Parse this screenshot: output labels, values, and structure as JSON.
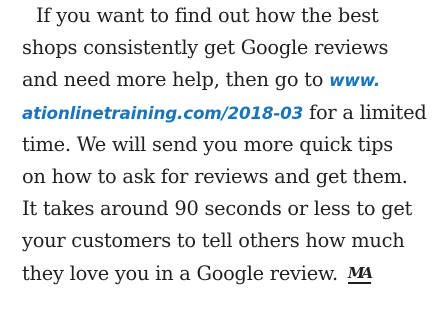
{
  "colors": {
    "text": "#231f20",
    "link": "#1a75bb"
  },
  "paragraph": {
    "lines": [
      {
        "text": "If you want to find out how the best"
      },
      {
        "text": "shops consistently get Google reviews"
      },
      {
        "before": "and need more help, then go to ",
        "link": "www."
      },
      {
        "link": "ationlinetraining.com/2018-03",
        "after": " for a limited"
      },
      {
        "text": "time. We will send you more quick tips"
      },
      {
        "text": "on how to ask for reviews and get them."
      },
      {
        "text": "It takes around 90 seconds or less to get"
      },
      {
        "text": "your customers to tell others how much"
      },
      {
        "text": "they love you in a Google review."
      }
    ],
    "end_mark": "MA"
  }
}
